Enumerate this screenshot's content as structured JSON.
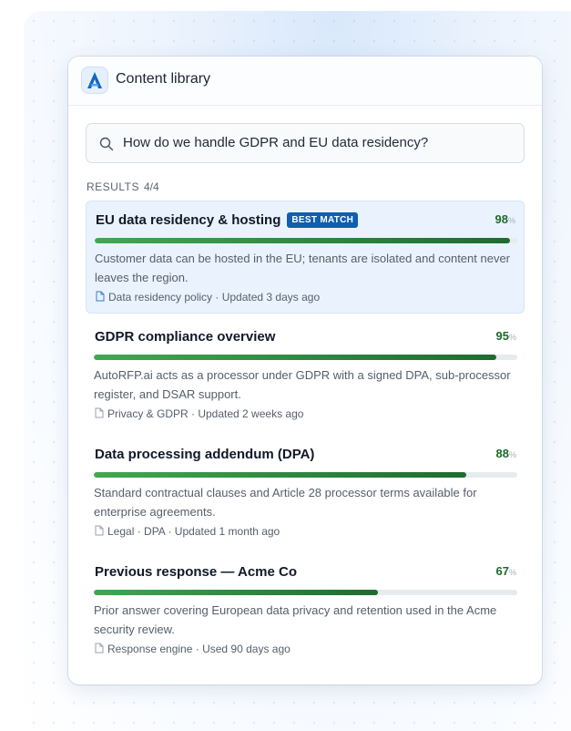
{
  "header": {
    "title": "Content library",
    "logo_icon": "autorfp-logo"
  },
  "search": {
    "query": "How do we handle GDPR and EU data residency?",
    "icon": "search-icon"
  },
  "results_header": {
    "label": "RESULTS",
    "count": "4/4"
  },
  "results": [
    {
      "title": "EU data residency & hosting",
      "badge": "BEST MATCH",
      "score": "98",
      "score_unit": "%",
      "score_fraction": 0.98,
      "description": "Customer data can be hosted in the EU; tenants are isolated and content never leaves the region.",
      "meta": "Data residency policy · Updated 3 days ago",
      "icon_color": "#2f7fd1"
    },
    {
      "title": "GDPR compliance overview",
      "badge": "",
      "score": "95",
      "score_unit": "%",
      "score_fraction": 0.95,
      "description": "AutoRFP.ai acts as a processor under GDPR with a signed DPA, sub-processor register, and DSAR support.",
      "meta": "Privacy & GDPR · Updated 2 weeks ago",
      "icon_color": "#9aa3ae"
    },
    {
      "title": "Data processing addendum (DPA)",
      "badge": "",
      "score": "88",
      "score_unit": "%",
      "score_fraction": 0.88,
      "description": "Standard contractual clauses and Article 28 processor terms available for enterprise agreements.",
      "meta": "Legal · DPA · Updated 1 month ago",
      "icon_color": "#9aa3ae"
    },
    {
      "title": "Previous response — Acme Co",
      "badge": "",
      "score": "67",
      "score_unit": "%",
      "score_fraction": 0.67,
      "description": "Prior answer covering European data privacy and retention used in the Acme security review.",
      "meta": "Response engine · Used 90 days ago",
      "icon_color": "#9aa3ae"
    }
  ],
  "colors": {
    "accent": "#0f5fae",
    "score_text": "#1e6a2c",
    "bar_start": "#43a751",
    "bar_end": "#1d6c30"
  }
}
